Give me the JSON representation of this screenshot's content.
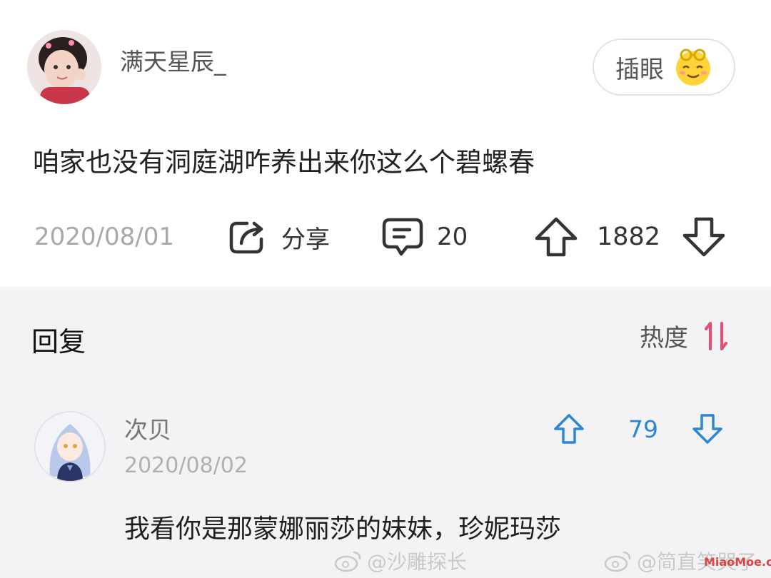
{
  "post": {
    "username": "满天星辰_",
    "insert_eye_label": "插眼",
    "comment": "咱家也没有洞庭湖咋养出来你这么个碧螺春",
    "date": "2020/08/01",
    "share_label": "分享",
    "comment_count": "20",
    "vote_count": "1882"
  },
  "replies_section": {
    "title": "回复",
    "sort_label": "热度",
    "accent_color": "#e84d72"
  },
  "reply": {
    "username": "次贝",
    "date": "2020/08/02",
    "vote_count": "79",
    "text": "我看你是那蒙娜丽莎的妹妹，珍妮玛莎",
    "accent_color": "#2b86d6"
  },
  "watermarks": {
    "left": "@沙雕探长",
    "right": "@简直笑哭了",
    "site": "MiaoMoe.com"
  },
  "icons": [
    "weibo-icon",
    "share-icon",
    "comment-icon",
    "upvote-icon",
    "downvote-icon",
    "sort-icon",
    "emoji-icon"
  ]
}
